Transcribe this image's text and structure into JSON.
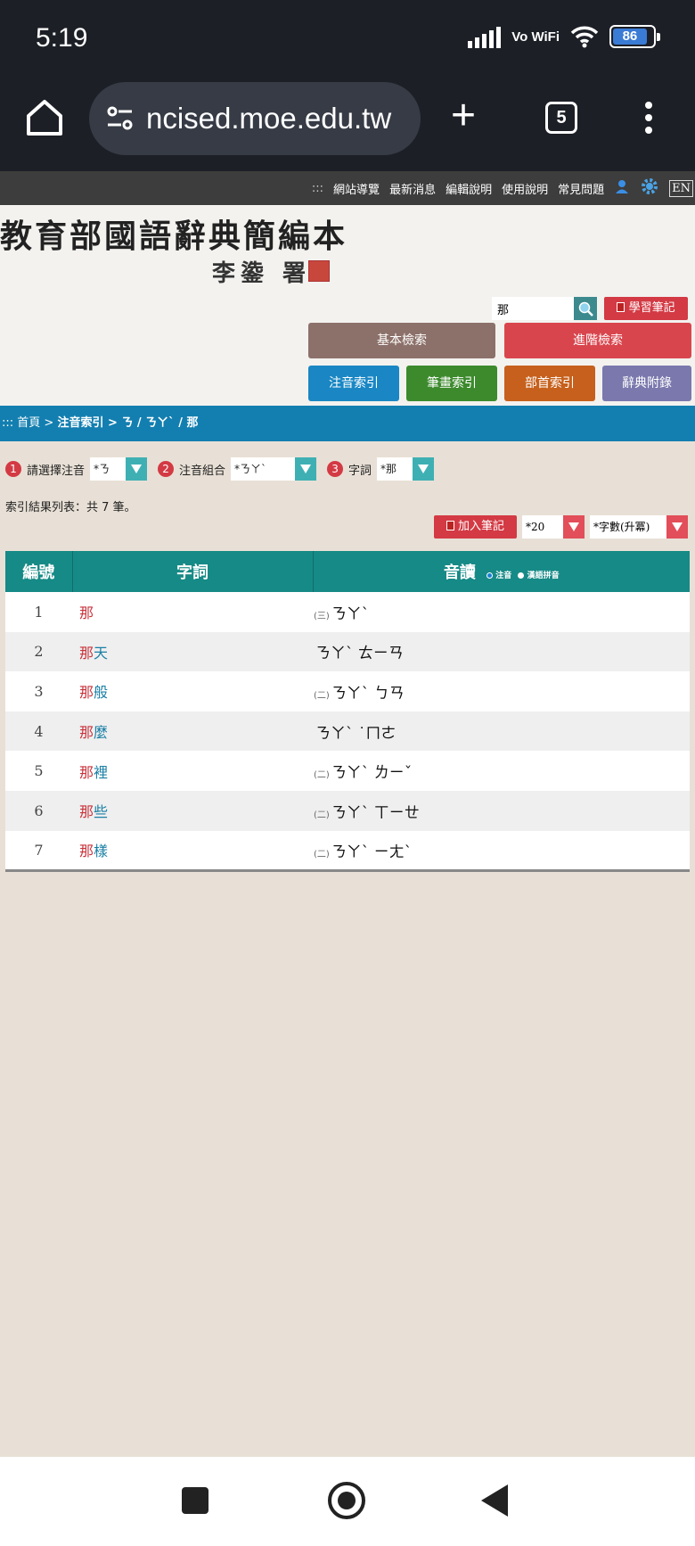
{
  "status": {
    "time": "5:19",
    "network": "Vo WiFi",
    "battery": "86"
  },
  "browser": {
    "url": "ncised.moe.edu.tw",
    "tab_count": "5"
  },
  "site_nav": {
    "items": [
      "網站導覽",
      "最新消息",
      "編輯說明",
      "使用說明",
      "常見問題"
    ],
    "dots": ":::",
    "lang": "EN"
  },
  "header": {
    "title": "教育部國語辭典簡編本",
    "subtitle": "李鍌 署",
    "search_value": "那",
    "notes_btn": "學習筆記",
    "basic_search": "基本檢索",
    "advanced_search": "進階檢索",
    "zhuyin_index": "注音索引",
    "stroke_index": "筆畫索引",
    "radical_index": "部首索引",
    "appendix": "辭典附錄"
  },
  "breadcrumb": {
    "prefix": "::: 首頁 > ",
    "current": "注音索引 > ㄋ / ㄋㄚˋ / 那"
  },
  "filters": {
    "step1_label": "請選擇注音",
    "step1_value": "*ㄋ",
    "step2_label": "注音組合",
    "step2_value": "*ㄋㄚˋ",
    "step3_label": "字詞",
    "step3_value": "*那"
  },
  "result_count": "索引結果列表：共 7 筆。",
  "tools": {
    "add_notes": "加入筆記",
    "page_size": "*20",
    "sort": "*字數(升冪)"
  },
  "table": {
    "headers": {
      "no": "編號",
      "word": "字詞",
      "pron": "音讀",
      "opt1": "注音",
      "opt2": "漢語拼音"
    },
    "rows": [
      {
        "no": "1",
        "w1": "那",
        "w2": "",
        "idx": "(三)",
        "pron": "ㄋㄚˋ"
      },
      {
        "no": "2",
        "w1": "那",
        "w2": "天",
        "idx": "",
        "pron": "ㄋㄚˋ ㄊㄧㄢ"
      },
      {
        "no": "3",
        "w1": "那",
        "w2": "般",
        "idx": "(二)",
        "pron": "ㄋㄚˋ ㄅㄢ"
      },
      {
        "no": "4",
        "w1": "那",
        "w2": "麼",
        "idx": "",
        "pron": "ㄋㄚˋ ˙ㄇㄜ"
      },
      {
        "no": "5",
        "w1": "那",
        "w2": "裡",
        "idx": "(二)",
        "pron": "ㄋㄚˋ ㄌㄧˇ"
      },
      {
        "no": "6",
        "w1": "那",
        "w2": "些",
        "idx": "(二)",
        "pron": "ㄋㄚˋ ㄒㄧㄝ"
      },
      {
        "no": "7",
        "w1": "那",
        "w2": "樣",
        "idx": "(二)",
        "pron": "ㄋㄚˋ ㄧㄤˋ"
      }
    ]
  }
}
